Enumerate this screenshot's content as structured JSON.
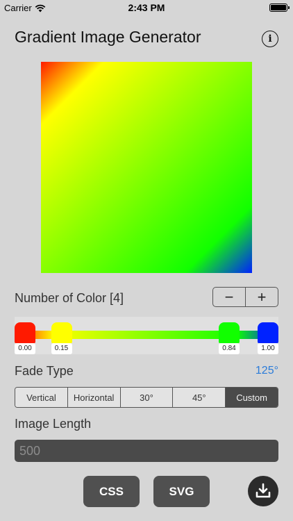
{
  "status_bar": {
    "carrier": "Carrier",
    "time": "2:43 PM"
  },
  "header": {
    "title": "Gradient Image Generator",
    "info_icon": "info-circle-icon",
    "info_glyph": "i"
  },
  "gradient": {
    "angle_deg": 125,
    "stops": [
      {
        "color": "#ff1a00",
        "position": 0.0,
        "label": "0.00"
      },
      {
        "color": "#ffff00",
        "position": 0.15,
        "label": "0.15"
      },
      {
        "color": "#11ff00",
        "position": 0.84,
        "label": "0.84"
      },
      {
        "color": "#0022ff",
        "position": 1.0,
        "label": "1.00"
      }
    ]
  },
  "color_count": {
    "label": "Number of Color [4]",
    "minus": "−",
    "plus": "+"
  },
  "fade": {
    "label": "Fade Type",
    "angle_text": "125°",
    "options": [
      "Vertical",
      "Horizontal",
      "30°",
      "45°",
      "Custom"
    ],
    "selected": "Custom"
  },
  "image_length": {
    "label": "Image Length",
    "value": "500"
  },
  "actions": {
    "css": "CSS",
    "svg": "SVG",
    "download_icon": "download-icon"
  },
  "colors": {
    "accent": "#2a7bd9",
    "dark_button": "#505050",
    "background": "#d6d6d6"
  }
}
